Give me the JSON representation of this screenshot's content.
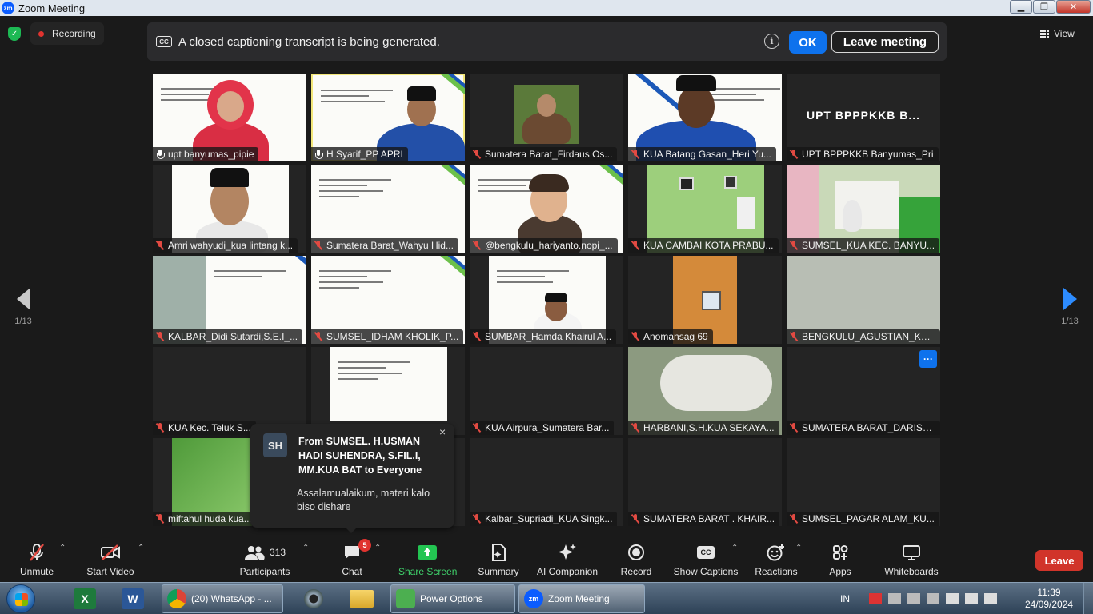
{
  "window": {
    "title": "Zoom Meeting"
  },
  "topbar": {
    "recording_label": "Recording",
    "caption_message": "A closed captioning transcript is being generated.",
    "cc_icon_text": "CC",
    "ok_label": "OK",
    "leave_meeting_label": "Leave meeting",
    "view_label": "View"
  },
  "pager": {
    "left": "1/13",
    "right": "1/13"
  },
  "tiles": [
    {
      "name": "upt banyumas_pipie",
      "muted": false
    },
    {
      "name": "H Syarif_PP APRI",
      "muted": false,
      "speaking": true
    },
    {
      "name": "Sumatera Barat_Firdaus Os...",
      "muted": true
    },
    {
      "name": "KUA Batang Gasan_Heri Yu...",
      "muted": true
    },
    {
      "name": "UPT BPPPKKB Banyumas_Pri",
      "muted": true,
      "big_name": "UPT BPPPKKB B..."
    },
    {
      "name": "Amri wahyudi_kua lintang k...",
      "muted": true
    },
    {
      "name": "Sumatera Barat_Wahyu Hid...",
      "muted": true
    },
    {
      "name": "@bengkulu_hariyanto.nopi_...",
      "muted": true
    },
    {
      "name": "KUA CAMBAI KOTA PRABU...",
      "muted": true
    },
    {
      "name": "SUMSEL_KUA KEC. BANYU...",
      "muted": true
    },
    {
      "name": "KALBAR_Didi Sutardi,S.E.I_...",
      "muted": true
    },
    {
      "name": "SUMSEL_IDHAM KHOLIK_P...",
      "muted": true
    },
    {
      "name": "SUMBAR_Hamda Khairul A...",
      "muted": true
    },
    {
      "name": "Anomansag 69",
      "muted": true
    },
    {
      "name": "BENGKULU_AGUSTIAN_KU...",
      "muted": true
    },
    {
      "name": "KUA Kec. Teluk S...",
      "muted": true
    },
    {
      "name": "",
      "muted": true
    },
    {
      "name": "KUA Airpura_Sumatera Bar...",
      "muted": true
    },
    {
      "name": "HARBANI,S.H.KUA SEKAYA...",
      "muted": true
    },
    {
      "name": "SUMATERA BARAT_DARISA...",
      "muted": true,
      "more_button": "···"
    },
    {
      "name": "miftahul huda kua...",
      "muted": true
    },
    {
      "name": "",
      "muted": true
    },
    {
      "name": "Kalbar_Supriadi_KUA Singk...",
      "muted": true
    },
    {
      "name": "SUMATERA BARAT . KHAIR...",
      "muted": true
    },
    {
      "name": "SUMSEL_PAGAR ALAM_KU...",
      "muted": true
    }
  ],
  "chat_toast": {
    "avatar_initials": "SH",
    "from": "From SUMSEL. H.USMAN HADI SUHENDRA, S.FIL.I, MM.KUA BAT to Everyone",
    "message": "Assalamualaikum, materi kalo biso dishare",
    "close": "×"
  },
  "toolbar": {
    "unmute": "Unmute",
    "start_video": "Start Video",
    "participants_count": "313",
    "participants": "Participants",
    "chat": "Chat",
    "chat_badge": "5",
    "share_screen": "Share Screen",
    "summary": "Summary",
    "ai_companion": "AI Companion",
    "record": "Record",
    "show_captions": "Show Captions",
    "reactions": "Reactions",
    "apps": "Apps",
    "whiteboards": "Whiteboards",
    "leave": "Leave"
  },
  "taskbar": {
    "tasks": [
      {
        "label": "(20) WhatsApp - ...",
        "icon_text": "",
        "color": "#db4437"
      },
      {
        "label": "Power Options",
        "icon_text": "",
        "color": "#4caf50"
      },
      {
        "label": "Zoom Meeting",
        "icon_text": "zm",
        "color": "#0b5cff"
      }
    ],
    "language": "IN",
    "time": "11:39",
    "date": "24/09/2024"
  }
}
